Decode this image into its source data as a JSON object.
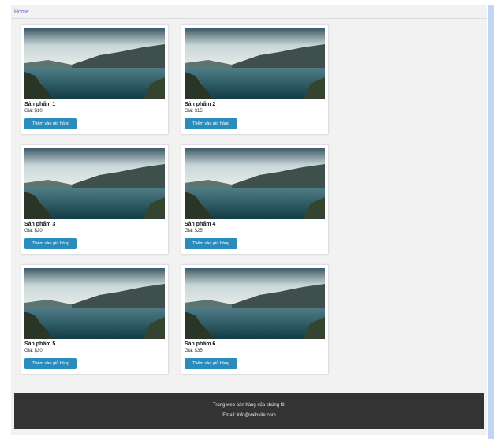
{
  "nav": {
    "home_label": "Home"
  },
  "products": [
    {
      "name": "Sản phẩm 1",
      "price": "Giá: $10",
      "button_label": "Thêm vào giỏ hàng",
      "image_icon": "landscape-image"
    },
    {
      "name": "Sản phẩm 2",
      "price": "Giá: $15",
      "button_label": "Thêm vào giỏ hàng",
      "image_icon": "landscape-image"
    },
    {
      "name": "Sản phẩm 3",
      "price": "Giá: $20",
      "button_label": "Thêm vào giỏ hàng",
      "image_icon": "landscape-image"
    },
    {
      "name": "Sản phẩm 4",
      "price": "Giá: $25",
      "button_label": "Thêm vào giỏ hàng",
      "image_icon": "landscape-image"
    },
    {
      "name": "Sản phẩm 5",
      "price": "Giá: $30",
      "button_label": "Thêm vào giỏ hàng",
      "image_icon": "landscape-image"
    },
    {
      "name": "Sản phẩm 6",
      "price": "Giá: $35",
      "button_label": "Thêm vào giỏ hàng",
      "image_icon": "landscape-image"
    }
  ],
  "footer": {
    "tagline": "Trang web bán hàng của chúng tôi",
    "email": "Email: info@website.com"
  },
  "colors": {
    "button": "#2a8bbd",
    "footer_bg": "#333333",
    "link": "#7a5bd6",
    "scrollbar": "#c3d5f5"
  }
}
